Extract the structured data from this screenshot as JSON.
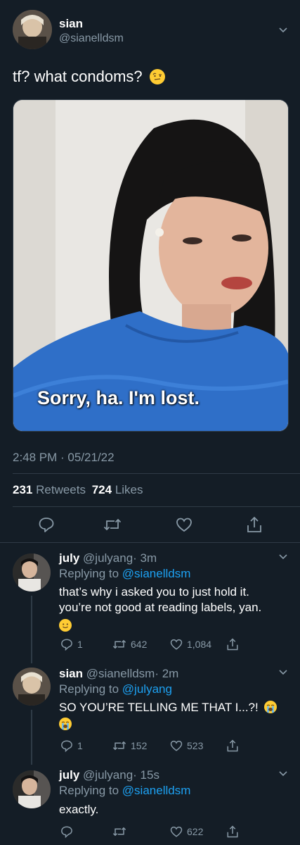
{
  "main_tweet": {
    "name": "sian",
    "handle": "@sianelldsm",
    "text": "tf? what condoms?",
    "emoji": "raised-eyebrow-face",
    "image_caption": "Sorry, ha. I'm lost.",
    "timestamp": "2:48 PM · 05/21/22",
    "retweets_count": "231",
    "retweets_label": "Retweets",
    "likes_count": "724",
    "likes_label": "Likes"
  },
  "replies": [
    {
      "name": "july",
      "handle": "@julyang",
      "time": "· 3m",
      "replying_prefix": "Replying to",
      "replying_to": "@sianelldsm",
      "text_line1": "that’s why i asked you to just hold it.",
      "text_line2": "you’re not good at reading labels, yan.",
      "emoji": "slightly-smiling-face",
      "reply_count": "1",
      "retweet_count": "642",
      "like_count": "1,084"
    },
    {
      "name": "sian",
      "handle": "@sianelldsm",
      "time": "· 2m",
      "replying_prefix": "Replying to",
      "replying_to": "@julyang",
      "text": "SO YOU’RE TELLING ME THAT I...?!",
      "emoji": "loudly-crying-face",
      "reply_count": "1",
      "retweet_count": "152",
      "like_count": "523"
    },
    {
      "name": "july",
      "handle": "@julyang",
      "time": "· 15s",
      "replying_prefix": "Replying to",
      "replying_to": "@sianelldsm",
      "text": "exactly.",
      "like_count": "622"
    }
  ],
  "colors": {
    "background": "#141d26",
    "muted": "#8899a6",
    "link": "#1da1f2",
    "divider": "#2f3b47"
  }
}
